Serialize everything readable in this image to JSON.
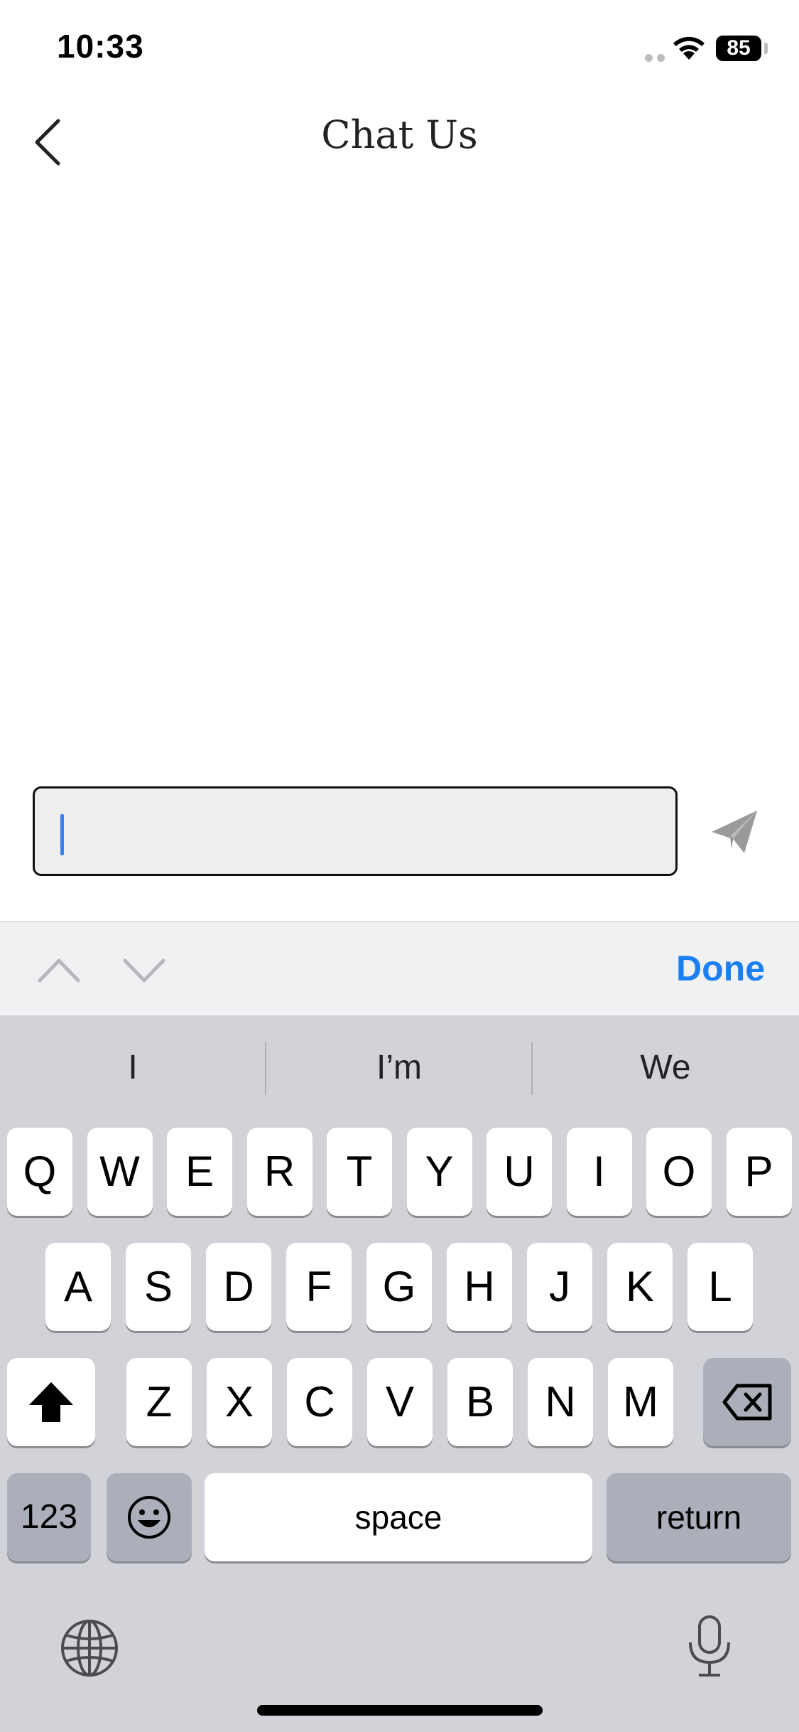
{
  "status_bar": {
    "time": "10:33",
    "battery": "85"
  },
  "header": {
    "title": "Chat Us"
  },
  "composer": {
    "value": "",
    "placeholder": ""
  },
  "toolbar": {
    "done_label": "Done"
  },
  "suggestions": [
    "I",
    "I’m",
    "We"
  ],
  "keyboard": {
    "row1": [
      "Q",
      "W",
      "E",
      "R",
      "T",
      "Y",
      "U",
      "I",
      "O",
      "P"
    ],
    "row2": [
      "A",
      "S",
      "D",
      "F",
      "G",
      "H",
      "J",
      "K",
      "L"
    ],
    "row3": [
      "Z",
      "X",
      "C",
      "V",
      "B",
      "N",
      "M"
    ],
    "numbers_label": "123",
    "space_label": "space",
    "return_label": "return"
  },
  "icons": {
    "back": "chevron-left-icon",
    "send": "paper-plane-icon",
    "shift": "shift-icon",
    "delete": "backspace-icon",
    "emoji": "emoji-icon",
    "globe": "globe-icon",
    "mic": "microphone-icon"
  },
  "colors": {
    "accent": "#1a7ff0",
    "keyboard_bg": "#d1d3d9",
    "input_bg": "#eeeeee"
  }
}
